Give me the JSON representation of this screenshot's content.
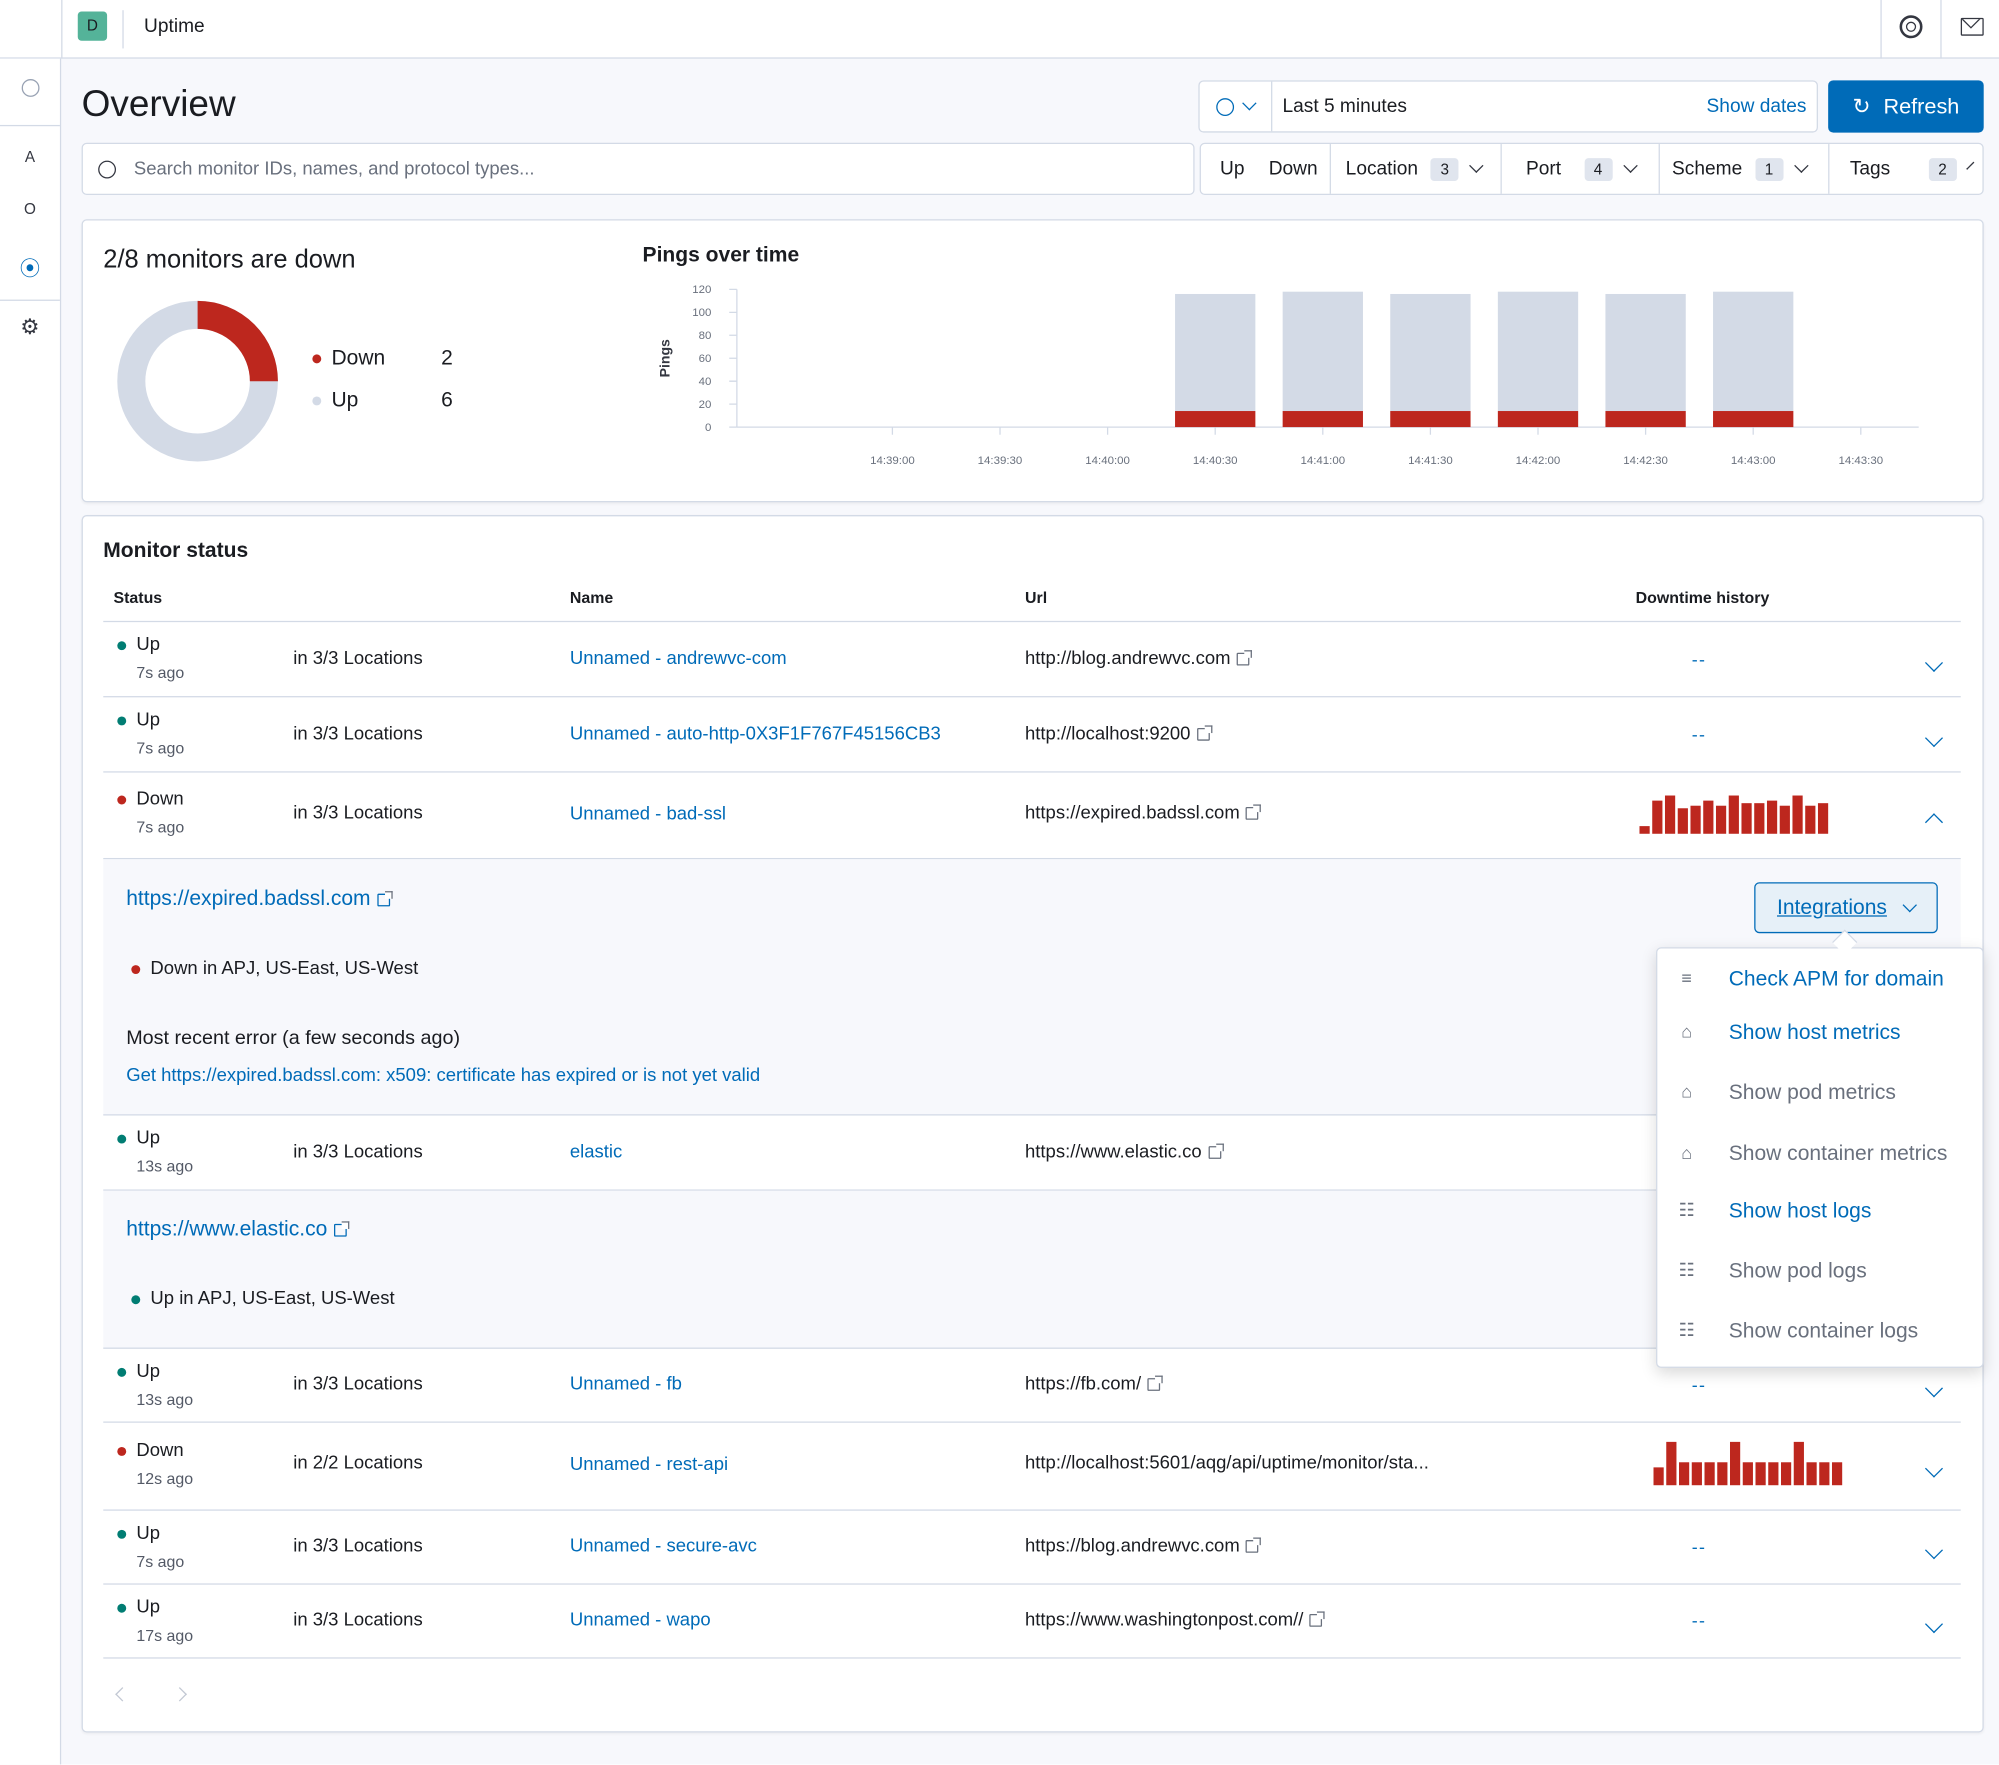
{
  "header": {
    "avatar_letter": "D",
    "app_title": "Uptime"
  },
  "nav": {
    "items": [
      "A",
      "O"
    ]
  },
  "page": {
    "title": "Overview"
  },
  "datepicker": {
    "range": "Last 5 minutes",
    "show_dates": "Show dates"
  },
  "refresh_label": "Refresh",
  "search": {
    "placeholder": "Search monitor IDs, names, and protocol types..."
  },
  "filters": {
    "up": "Up",
    "down": "Down",
    "groups": [
      {
        "label": "Location",
        "count": "3"
      },
      {
        "label": "Port",
        "count": "4"
      },
      {
        "label": "Scheme",
        "count": "1"
      },
      {
        "label": "Tags",
        "count": "2"
      }
    ]
  },
  "snapshot": {
    "title": "2/8 monitors are down",
    "legend": [
      {
        "label": "Down",
        "value": "2",
        "color": "#bd271e"
      },
      {
        "label": "Up",
        "value": "6",
        "color": "#d3dae6"
      }
    ]
  },
  "chart_data": {
    "type": "bar",
    "title": "Pings over time",
    "ylabel": "Pings",
    "ylim": [
      0,
      120
    ],
    "y_ticks": [
      "0",
      "20",
      "40",
      "60",
      "80",
      "100",
      "120"
    ],
    "x_ticks": [
      "14:39:00",
      "14:39:30",
      "14:40:00",
      "14:40:30",
      "14:41:00",
      "14:41:30",
      "14:42:00",
      "14:42:30",
      "14:43:00",
      "14:43:30"
    ],
    "categories": [
      "14:40:30",
      "14:41:00",
      "14:41:30",
      "14:42:00",
      "14:42:30",
      "14:43:00"
    ],
    "stacked": true,
    "series": [
      {
        "name": "Down",
        "color": "#bd271e",
        "values": [
          14,
          14,
          14,
          14,
          14,
          14
        ]
      },
      {
        "name": "Up",
        "color": "#d3dae6",
        "values": [
          102,
          104,
          102,
          104,
          102,
          104
        ]
      }
    ]
  },
  "monitor_status": {
    "title": "Monitor status",
    "columns": {
      "status": "Status",
      "name": "Name",
      "url": "Url",
      "history": "Downtime history"
    },
    "rows": [
      {
        "status": "Up",
        "ago": "7s ago",
        "locations": "in 3/3 Locations",
        "name": "Unnamed - andrewvc-com",
        "url": "http://blog.andrewvc.com",
        "history": "--"
      },
      {
        "status": "Up",
        "ago": "7s ago",
        "locations": "in 3/3 Locations",
        "name": "Unnamed - auto-http-0X3F1F767F45156CB3",
        "url": "http://localhost:9200",
        "history": "--"
      },
      {
        "status": "Down",
        "ago": "7s ago",
        "locations": "in 3/3 Locations",
        "name": "Unnamed - bad-ssl",
        "url": "https://expired.badssl.com",
        "history": ""
      },
      {
        "status": "Up",
        "ago": "13s ago",
        "locations": "in 3/3 Locations",
        "name": "elastic",
        "url": "https://www.elastic.co",
        "history": ""
      },
      {
        "status": "Up",
        "ago": "13s ago",
        "locations": "in 3/3 Locations",
        "name": "Unnamed - fb",
        "url": "https://fb.com/",
        "history": "--"
      },
      {
        "status": "Down",
        "ago": "12s ago",
        "locations": "in 2/2 Locations",
        "name": "Unnamed - rest-api",
        "url": "http://localhost:5601/aqg/api/uptime/monitor/sta...",
        "history": ""
      },
      {
        "status": "Up",
        "ago": "7s ago",
        "locations": "in 3/3 Locations",
        "name": "Unnamed - secure-avc",
        "url": "https://blog.andrewvc.com",
        "history": "--"
      },
      {
        "status": "Up",
        "ago": "17s ago",
        "locations": "in 3/3 Locations",
        "name": "Unnamed - wapo",
        "url": "https://www.washingtonpost.com//",
        "history": "--"
      }
    ],
    "expanded_badssl": {
      "link": "https://expired.badssl.com",
      "locations": "Down in APJ, US-East, US-West",
      "error_title": "Most recent error (a few seconds ago)",
      "error_message": "Get https://expired.badssl.com: x509: certificate has expired or is not yet valid"
    },
    "expanded_elastic": {
      "link": "https://www.elastic.co",
      "locations": "Up in APJ, US-East, US-West"
    }
  },
  "sparklines": {
    "badssl": [
      3,
      13,
      15,
      10,
      11,
      13,
      11,
      15,
      12,
      12,
      13,
      11,
      15,
      11,
      12
    ],
    "restapi": [
      7,
      17,
      9,
      9,
      9,
      9,
      17,
      9,
      9,
      9,
      9,
      17,
      9,
      9,
      9
    ]
  },
  "integrations": {
    "button": "Integrations",
    "items": [
      {
        "label": "Check APM for domain",
        "enabled": true,
        "icon": "apm-icon"
      },
      {
        "label": "Show host metrics",
        "enabled": true,
        "icon": "metrics-icon"
      },
      {
        "label": "Show pod metrics",
        "enabled": false,
        "icon": "metrics-icon"
      },
      {
        "label": "Show container metrics",
        "enabled": false,
        "icon": "metrics-icon"
      },
      {
        "label": "Show host logs",
        "enabled": true,
        "icon": "logs-icon"
      },
      {
        "label": "Show pod logs",
        "enabled": false,
        "icon": "logs-icon"
      },
      {
        "label": "Show container logs",
        "enabled": false,
        "icon": "logs-icon"
      }
    ]
  },
  "colors": {
    "accent": "#006bb8",
    "down": "#bd271e",
    "up": "#017d73",
    "neutral": "#d3dae6"
  }
}
